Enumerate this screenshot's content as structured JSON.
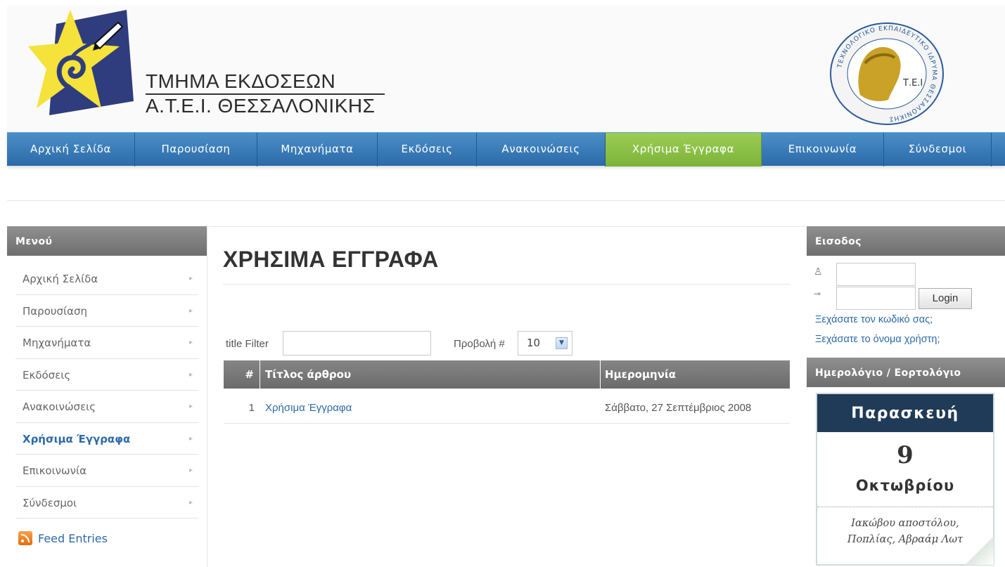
{
  "header": {
    "org_title_line1": "ΤΜΗΜΑ ΕΚΔΟΣΕΩΝ",
    "org_title_line2": "Α.Τ.Ε.Ι. ΘΕΣΣΑΛΟΝΙΚΗΣ",
    "seal_text": "ΤΕΧΝΟΛΟΓΙΚΟ ΕΚΠΑΙΔΕΥΤΙΚΟ ΙΔΡΥΜΑ ΘΕΣΣΑΛΟΝΙΚΗΣ",
    "seal_letters": "Τ.Ε.Ι"
  },
  "nav": {
    "items": [
      {
        "label": "Αρχική Σελίδα"
      },
      {
        "label": "Παρουσίαση"
      },
      {
        "label": "Μηχανήματα"
      },
      {
        "label": "Εκδόσεις"
      },
      {
        "label": "Ανακοινώσεις"
      },
      {
        "label": "Χρήσιμα Έγγραφα"
      },
      {
        "label": "Επικοινωνία"
      },
      {
        "label": "Σύνδεσμοι"
      }
    ],
    "active_index": 5
  },
  "sidebar": {
    "title": "Μενού",
    "items": [
      {
        "label": "Αρχική Σελίδα"
      },
      {
        "label": "Παρουσίαση"
      },
      {
        "label": "Μηχανήματα"
      },
      {
        "label": "Εκδόσεις"
      },
      {
        "label": "Ανακοινώσεις"
      },
      {
        "label": "Χρήσιμα Έγγραφα"
      },
      {
        "label": "Επικοινωνία"
      },
      {
        "label": "Σύνδεσμοι"
      }
    ],
    "active_index": 5,
    "feed_label": "Feed Entries"
  },
  "main": {
    "page_title": "ΧΡΗΣΙΜΑ ΕΓΓΡΑΦΑ",
    "filter_label": "title Filter",
    "filter_value": "",
    "display_label": "Προβολή #",
    "display_value": "10",
    "table": {
      "headers": [
        "#",
        "Τίτλος άρθρου",
        "Ημερομηνία"
      ],
      "rows": [
        {
          "num": "1",
          "title": "Χρήσιμα Έγγραφα",
          "date": "Σάββατο, 27 Σεπτέμβριος 2008"
        }
      ]
    }
  },
  "login": {
    "title": "Εισοδος",
    "username_value": "",
    "password_value": "",
    "button_label": "Login",
    "forgot_password": "Ξεχάσατε τον κωδικό σας;",
    "forgot_username": "Ξεχάσατε το όνομα χρήστη;"
  },
  "calendar": {
    "title": "Ημερολόγιο / Εορτολόγιο",
    "day_name": "Παρασκευή",
    "date": "9",
    "month": "Οκτωβρίου",
    "names_line1": "Ιακώβου αποστόλου,",
    "names_line2": "Πoπλίας, Αβραάμ Λωτ"
  },
  "colors": {
    "nav_blue": "#2c6aa8",
    "nav_active_green": "#8bc34a",
    "link_blue": "#2c6aa8",
    "header_gray": "#7a7a7a",
    "calendar_navy": "#1f3b57"
  }
}
